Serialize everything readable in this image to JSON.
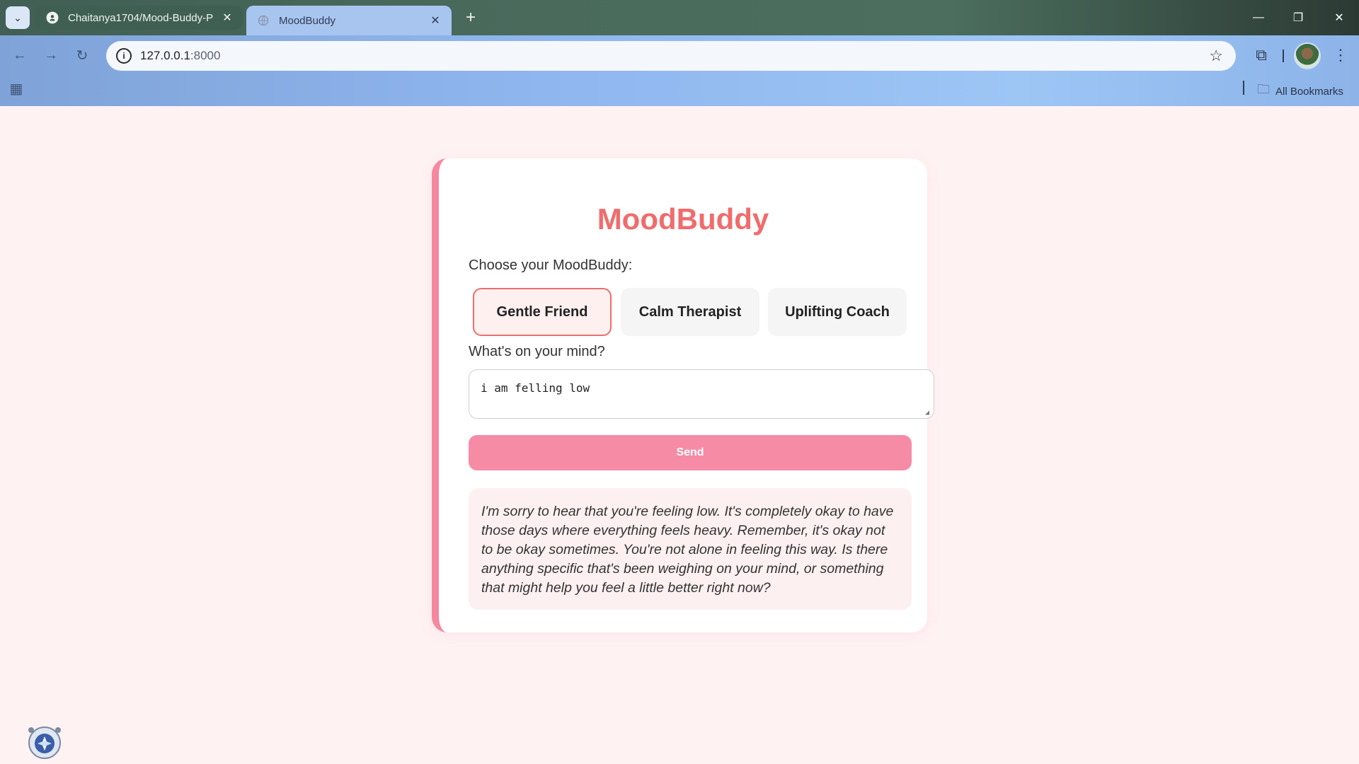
{
  "browser": {
    "tabs": [
      {
        "title": "Chaitanya1704/Mood-Buddy-P",
        "favicon": "github-icon",
        "active": false
      },
      {
        "title": "MoodBuddy",
        "favicon": "globe-icon",
        "active": true
      }
    ],
    "address": {
      "host": "127.0.0.1",
      "port": ":8000"
    },
    "bookmarks_label": "All Bookmarks"
  },
  "app": {
    "title": "MoodBuddy",
    "choose_label": "Choose your MoodBuddy:",
    "personas": [
      "Gentle Friend",
      "Calm Therapist",
      "Uplifting Coach"
    ],
    "selected_persona": "Gentle Friend",
    "mind_label": "What's on your mind?",
    "input_value": "i am felling low",
    "send_label": "Send",
    "response": "I'm sorry to hear that you're feeling low. It's completely okay to have those days where everything feels heavy. Remember, it's okay not to be okay sometimes. You're not alone in feeling this way. Is there anything specific that's been weighing on your mind, or something that might help you feel a little better right now?"
  },
  "colors": {
    "accent": "#f06c6c",
    "send_button": "#f68ba6",
    "card_border": "#f5879f",
    "page_background": "#fff2f3",
    "response_background": "#fdf0f1"
  }
}
